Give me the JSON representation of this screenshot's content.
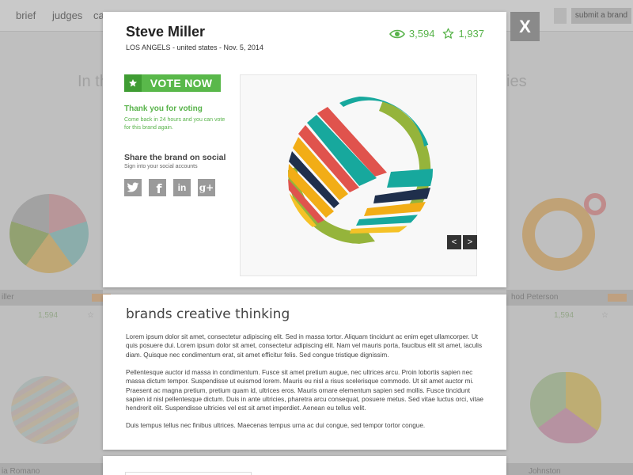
{
  "background": {
    "nav": [
      "brief",
      "judges",
      "ca"
    ],
    "submit_label": "submit a brand",
    "heading_left": "In th",
    "heading_right": "ies",
    "cards": [
      {
        "name": "iller",
        "stat": "1,594"
      },
      {
        "name": "hod Peterson",
        "stat": "1,594"
      },
      {
        "name": "ia Romano"
      },
      {
        "name": "Johnston"
      }
    ]
  },
  "modal": {
    "close_label": "X",
    "artist_name": "Steve Miller",
    "meta": "LOS ANGELS - united states - Nov. 5, 2014",
    "views": "3,594",
    "favorites": "1,937",
    "vote_label": "VOTE NOW",
    "thanks_title": "Thank you for voting",
    "thanks_text": "Come back in 24 hours and you can vote for this brand again.",
    "share_title": "Share the brand on social",
    "share_sub": "Sign into your social accounts",
    "social": {
      "twitter": "t",
      "facebook": "f",
      "linkedin": "in",
      "googleplus": "g+"
    },
    "gallery": {
      "prev": "<",
      "next": ">"
    },
    "section_title": "brands creative thinking",
    "paragraphs": [
      "Lorem ipsum dolor sit amet, consectetur adipiscing elit. Sed in massa tortor. Aliquam tincidunt ac enim eget ullamcorper. Ut quis posuere dui. Lorem ipsum dolor sit amet, consectetur adipiscing elit. Nam vel mauris porta, faucibus elit sit amet, iaculis diam. Quisque nec condimentum erat, sit amet efficitur felis. Sed congue tristique dignissim.",
      "Pellentesque auctor id massa in condimentum. Fusce sit amet pretium augue, nec ultrices arcu. Proin lobortis sapien nec massa dictum tempor. Suspendisse ut euismod lorem. Mauris eu nisl a risus scelerisque commodo. Ut sit amet auctor mi. Praesent ac magna pretium, pretium quam id, ultrices eros. Mauris ornare elementum sapien sed mollis. Fusce tincidunt sapien id nisl pellentesque dictum. Duis in ante ultricies, pharetra arcu consequat, posuere metus. Sed vitae luctus orci, vitae hendrerit elit. Suspendisse ultricies vel est sit amet imperdiet. Aenean eu tellus velit.",
      "Duis tempus tellus nec finibus ultrices. Maecenas tempus urna ac dui congue, sed tempor tortor congue."
    ]
  },
  "colors": {
    "accent_green": "#59b84a",
    "close_gray": "#8a8a8a"
  }
}
